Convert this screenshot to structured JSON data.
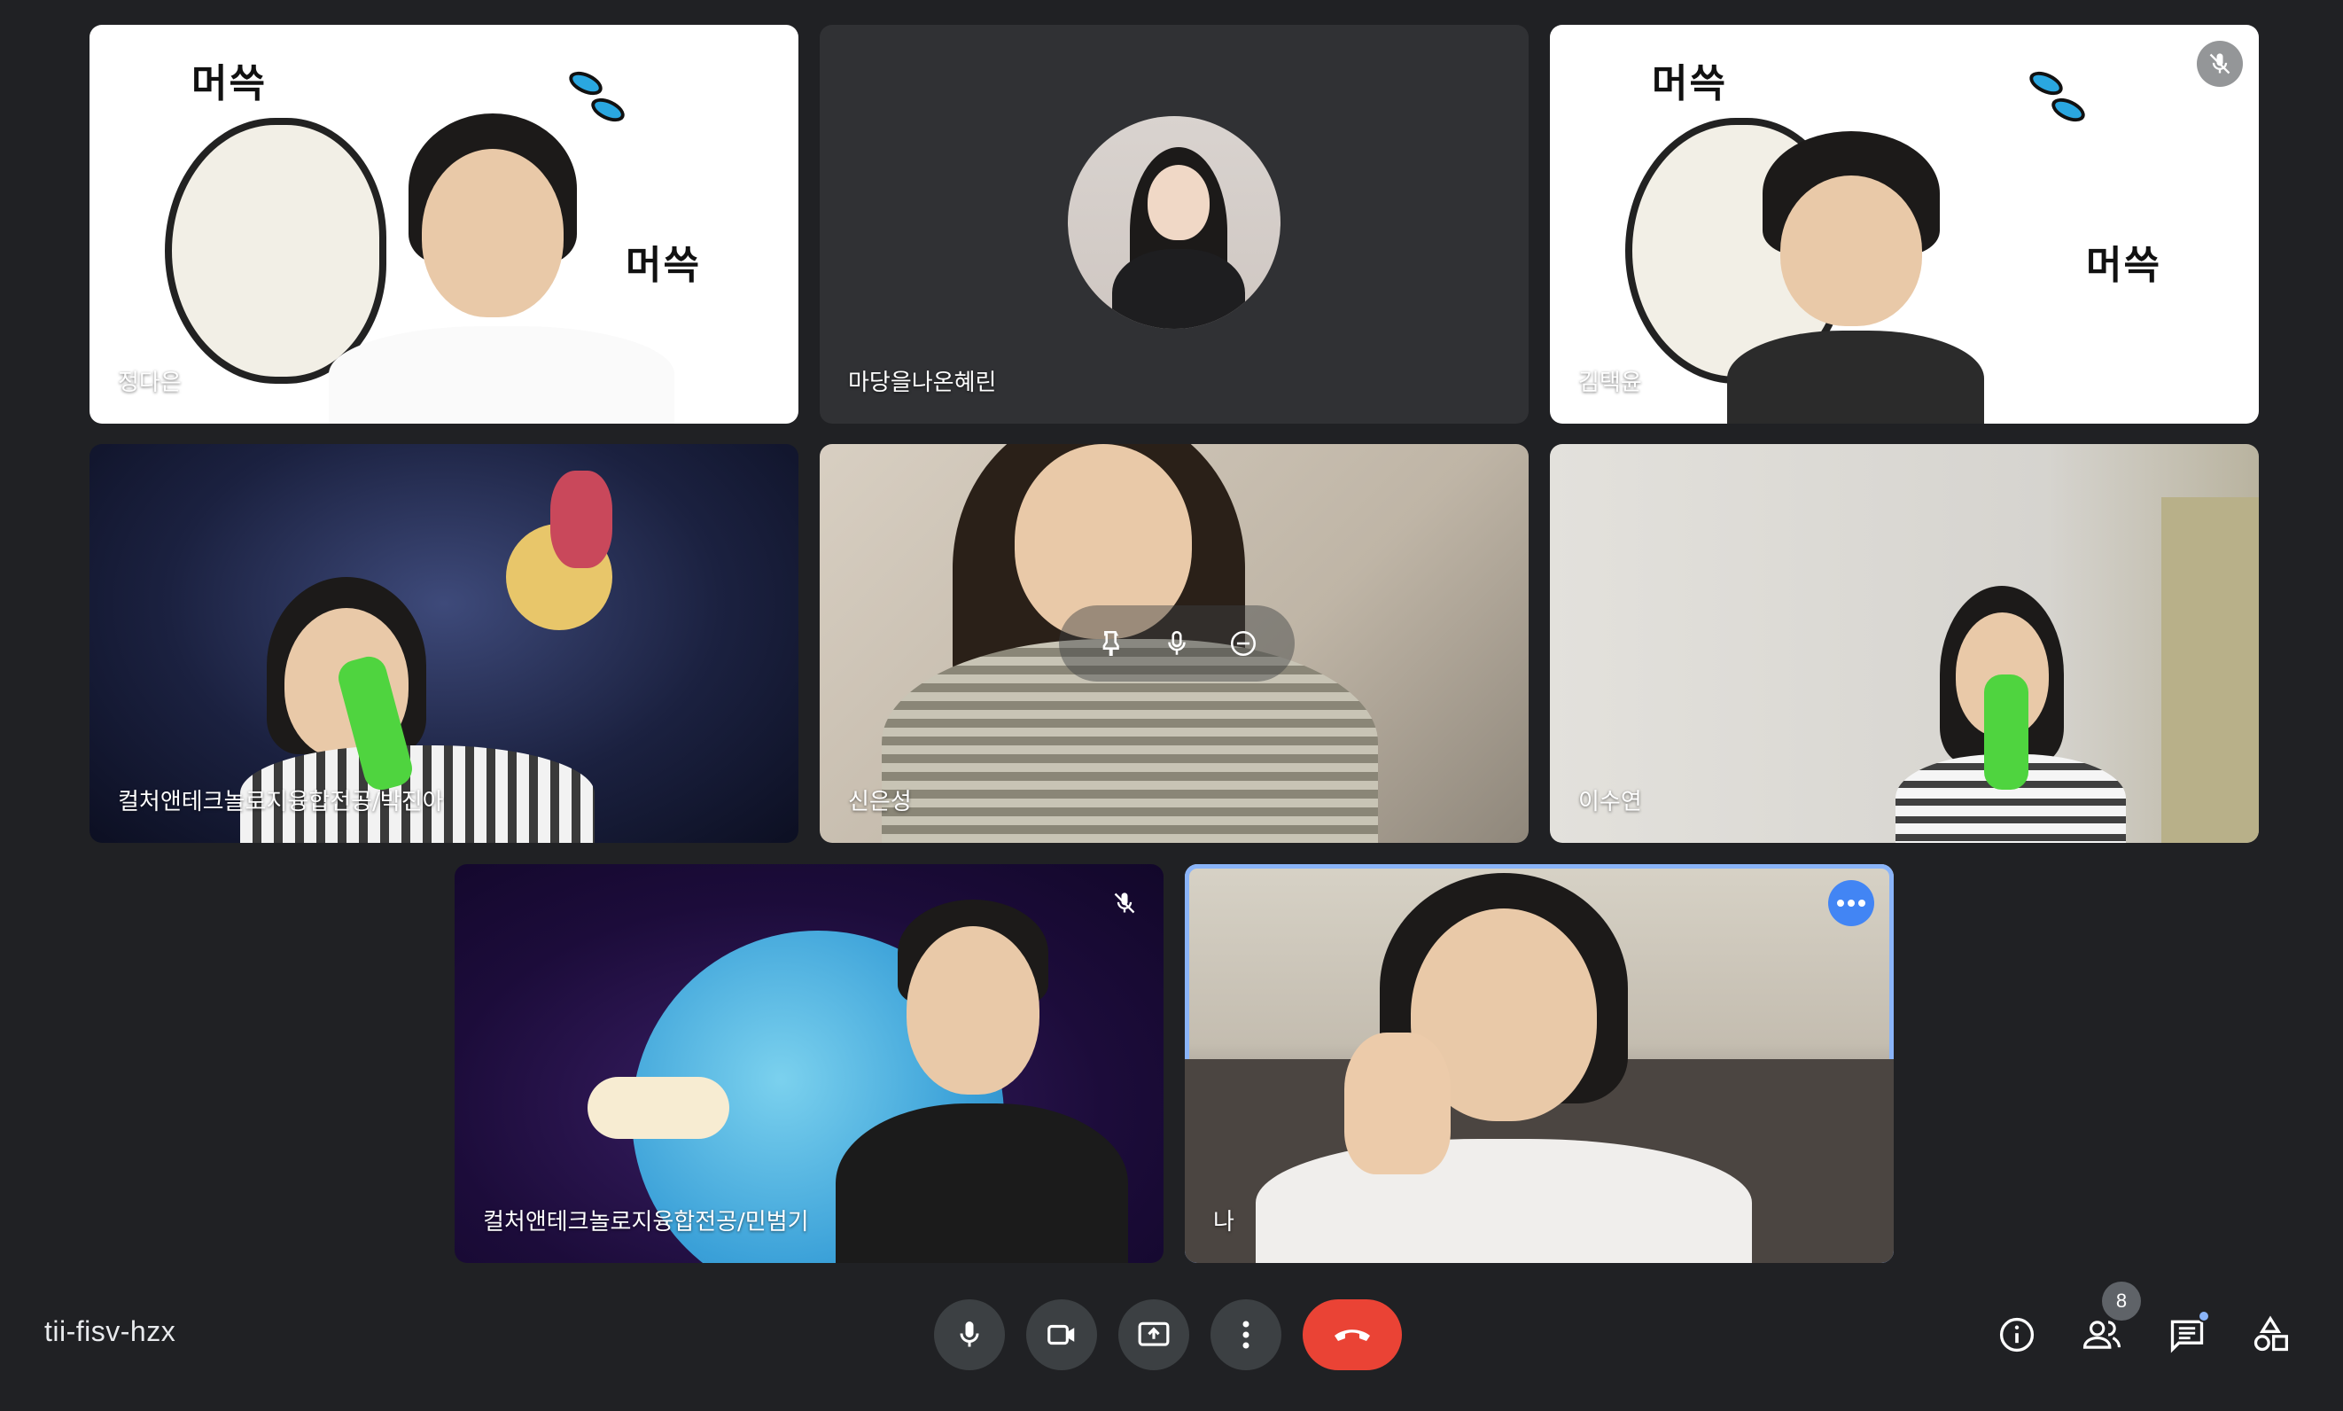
{
  "participants": [
    {
      "name": "정다은"
    },
    {
      "name": "마당을나온혜린"
    },
    {
      "name": "김택윤"
    },
    {
      "name": "컬처앤테크놀로지융합전공/박진아"
    },
    {
      "name": "신은성"
    },
    {
      "name": "이수연"
    },
    {
      "name": "컬처앤테크놀로지융합전공/민범기"
    },
    {
      "name": "나"
    }
  ],
  "stickers": {
    "text_top": "머쓱",
    "text_side": "머쓱"
  },
  "meeting": {
    "code": "tii-fisv-hzx",
    "participant_count": "8"
  },
  "controls": {
    "mic_icon": "mic-icon",
    "camera_icon": "videocam-icon",
    "present_icon": "present-screen-icon",
    "more_icon": "more-vert-icon",
    "end_call_icon": "call-end-icon",
    "info_icon": "info-icon",
    "people_icon": "people-icon",
    "chat_icon": "chat-icon",
    "activities_icon": "activities-icon"
  },
  "colors": {
    "background": "#202124",
    "tile": "#3c4043",
    "end_call": "#ea4335",
    "self_outline": "#8ab4f8",
    "more_badge": "#4285f4"
  }
}
